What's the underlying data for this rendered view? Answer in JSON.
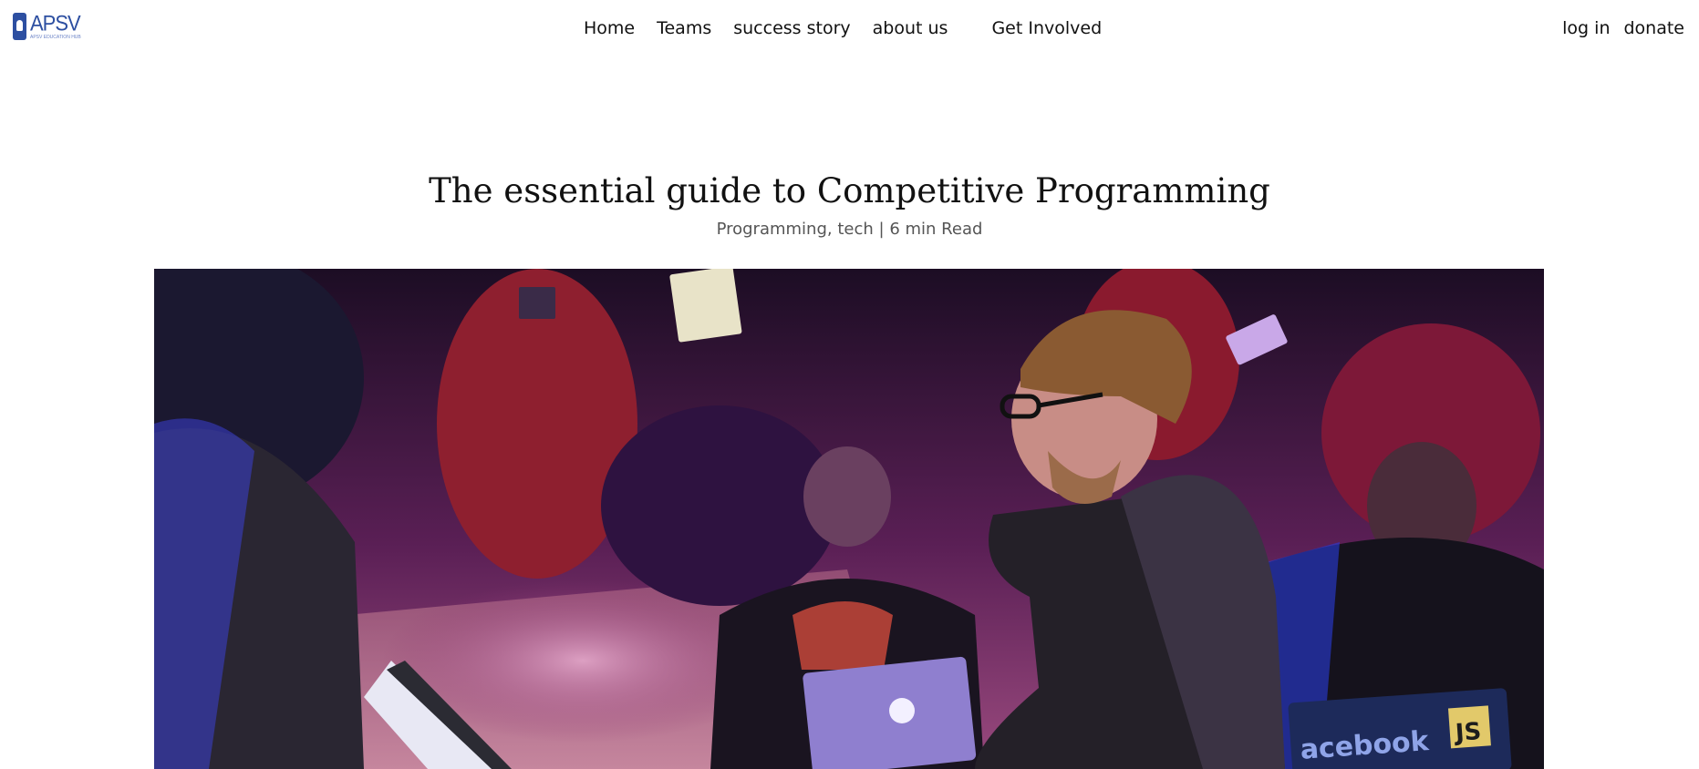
{
  "brand": {
    "logo_text": "APSV",
    "logo_tagline": "APSV EDUCATION HUB"
  },
  "nav": {
    "center": [
      "Home",
      "Teams",
      "success story",
      "about us",
      "Get Involved"
    ],
    "right": [
      "log in",
      "donate"
    ]
  },
  "article": {
    "title": "The essential guide to Competitive Programming",
    "categories": "Programming, tech",
    "separator": "|",
    "read_time": "6 min Read"
  },
  "hero": {
    "laptop_sticker": "acebook",
    "js_sticker": "JS"
  },
  "colors": {
    "brand_blue": "#2d4fa1",
    "text": "#111111",
    "meta": "#555555"
  }
}
